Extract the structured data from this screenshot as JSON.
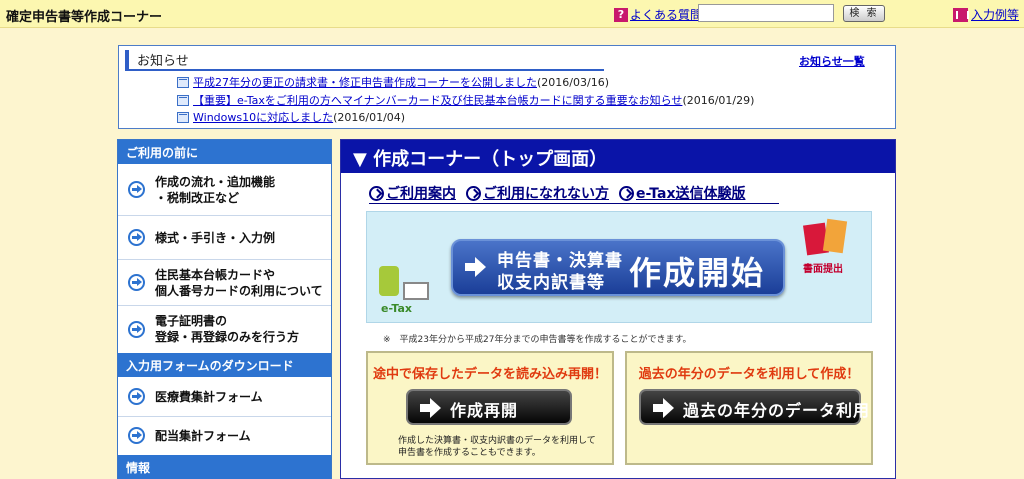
{
  "header": {
    "title": "確定申告書等作成コーナー",
    "faq_label": "よくある質問",
    "search_placeholder": "",
    "search_button": "検 索",
    "example_label": "入力例等"
  },
  "news": {
    "heading": "お知らせ",
    "all_link": "お知らせ一覧",
    "items": [
      {
        "link": "平成27年分の更正の請求書・修正申告書作成コーナーを公開しました",
        "date": "(2016/03/16)"
      },
      {
        "link": "【重要】e-Taxをご利用の方へマイナンバーカード及び住民基本台帳カードに関する重要なお知らせ",
        "date": "(2016/01/29)"
      },
      {
        "link": "Windows10に対応しました",
        "date": "(2016/01/04)"
      }
    ]
  },
  "sidebar": {
    "section1": "ご利用の前に",
    "items1": [
      {
        "line1": "作成の流れ・追加機能",
        "line2": "・税制改正など"
      },
      {
        "line1": "様式・手引き・入力例",
        "line2": ""
      },
      {
        "line1": "住民基本台帳カードや",
        "line2": "個人番号カードの利用について"
      },
      {
        "line1": "電子証明書の",
        "line2": "登録・再登録のみを行う方"
      }
    ],
    "section2": "入力用フォームのダウンロード",
    "items2": [
      {
        "line1": "医療費集計フォーム"
      },
      {
        "line1": "配当集計フォーム"
      }
    ],
    "section3": "情報"
  },
  "main": {
    "heading": "▼ 作成コーナー（トップ画面）",
    "links": [
      "ご利用案内",
      "ご利用になれない方",
      "e-Tax送信体験版"
    ],
    "etax_label": "e-Tax",
    "start_line1": "申告書・決算書",
    "start_line2": "収支内訳書等",
    "start_main": "作成開始",
    "shomen_label": "書面提出",
    "note": "※　平成23年分から平成27年分までの申告書等を作成することができます。",
    "resume": {
      "title": "途中で保存したデータを読み込み再開！",
      "button": "作成再開",
      "desc1": "作成した決算書・収支内訳書のデータを利用して",
      "desc2": "申告書を作成することもできます。"
    },
    "past": {
      "title": "過去の年分のデータを利用して作成！",
      "button": "過去の年分のデータ利用"
    }
  }
}
